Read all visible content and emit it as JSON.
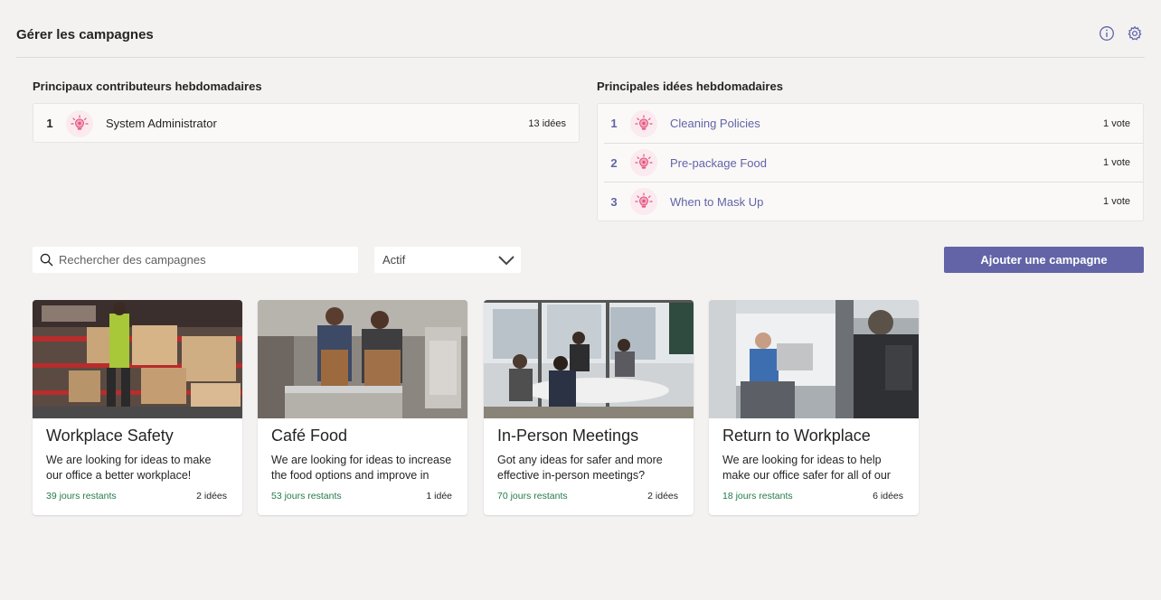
{
  "header": {
    "title": "Gérer les campagnes",
    "info_icon": "info-icon",
    "settings_icon": "gear-icon"
  },
  "contributors": {
    "label": "Principaux contributeurs hebdomadaires",
    "items": [
      {
        "rank": "1",
        "name": "System Administrator",
        "count": "13 idées",
        "icon": "lightbulb-icon"
      }
    ]
  },
  "ideas": {
    "label": "Principales idées hebdomadaires",
    "items": [
      {
        "rank": "1",
        "name": "Cleaning Policies",
        "votes": "1 vote",
        "icon": "lightbulb-icon"
      },
      {
        "rank": "2",
        "name": "Pre-package Food",
        "votes": "1 vote",
        "icon": "lightbulb-icon"
      },
      {
        "rank": "3",
        "name": "When to Mask Up",
        "votes": "1 vote",
        "icon": "lightbulb-icon"
      }
    ]
  },
  "toolbar": {
    "search_placeholder": "Rechercher des campagnes",
    "filter_value": "Actif",
    "add_label": "Ajouter une campagne"
  },
  "campaigns": [
    {
      "title": "Workplace Safety",
      "description": "We are looking for ideas to make our office a better workplace!",
      "days": "39 jours restants",
      "ideas": "2 idées"
    },
    {
      "title": "Café Food",
      "description": "We are looking for ideas to increase the food options and improve in",
      "days": "53 jours restants",
      "ideas": "1 idée"
    },
    {
      "title": "In-Person Meetings",
      "description": "Got any ideas for safer and more effective in-person meetings?",
      "days": "70 jours restants",
      "ideas": "2 idées"
    },
    {
      "title": "Return to Workplace",
      "description": "We are looking for ideas to help make our office safer for all of our",
      "days": "18 jours restants",
      "ideas": "6 idées"
    }
  ],
  "colors": {
    "accent": "#6264a7",
    "days_green": "#237b4b",
    "background": "#f3f2f1"
  }
}
